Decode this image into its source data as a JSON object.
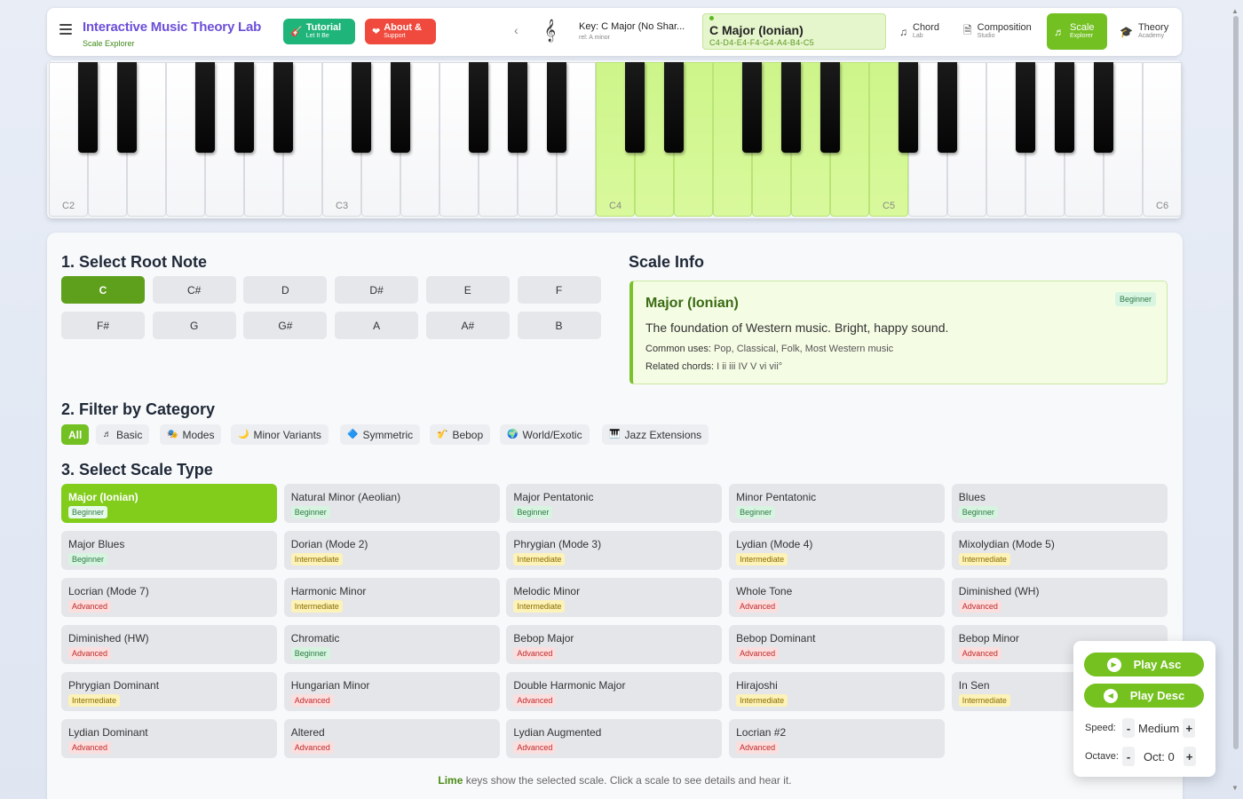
{
  "header": {
    "title": "Interactive Music Theory Lab",
    "subtitle": "Scale Explorer",
    "tutorial": {
      "t1": "Tutorial",
      "t2": "Let It Be"
    },
    "about": {
      "t1": "About &",
      "t2": "Support"
    },
    "key_line1": "Key: C Major (No Shar...",
    "key_line2": "rel: A minor",
    "scale_title": "C Major (Ionian)",
    "scale_notes": "C4-D4-E4-F4-G4-A4-B4-C5",
    "nav": [
      {
        "t1": "Chord",
        "t2": "Lab"
      },
      {
        "t1": "Composition",
        "t2": "Studio"
      },
      {
        "t1": "Scale",
        "t2": "Explorer"
      },
      {
        "t1": "Theory",
        "t2": "Academy"
      }
    ],
    "accent": "#72c022"
  },
  "piano": {
    "white_count": 29,
    "lit_from": 14,
    "lit_to": 21,
    "labels": [
      {
        "index": 0,
        "text": "C2"
      },
      {
        "index": 7,
        "text": "C3"
      },
      {
        "index": 14,
        "text": "C4"
      },
      {
        "index": 21,
        "text": "C5"
      },
      {
        "index": 28,
        "text": "C6"
      }
    ]
  },
  "root": {
    "heading": "1. Select Root Note",
    "notes": [
      "C",
      "C#",
      "D",
      "D#",
      "E",
      "F",
      "F#",
      "G",
      "G#",
      "A",
      "A#",
      "B"
    ],
    "selected": "C"
  },
  "info": {
    "heading": "Scale Info",
    "title": "Major (Ionian)",
    "level": "Beginner",
    "description": "The foundation of Western music. Bright, happy sound.",
    "uses_label": "Common uses:",
    "uses": "Pop, Classical, Folk, Most Western music",
    "chords_label": "Related chords:",
    "chords": "I ii iii IV V vi vii°"
  },
  "filter": {
    "heading": "2. Filter by Category",
    "items": [
      {
        "icon": "",
        "label": "All"
      },
      {
        "icon": "♬",
        "label": "Basic"
      },
      {
        "icon": "🎭",
        "label": "Modes"
      },
      {
        "icon": "🌙",
        "label": "Minor Variants"
      },
      {
        "icon": "🔷",
        "label": "Symmetric"
      },
      {
        "icon": "🎷",
        "label": "Bebop"
      },
      {
        "icon": "🌍",
        "label": "World/Exotic"
      },
      {
        "icon": "🎹",
        "label": "Jazz Extensions"
      }
    ]
  },
  "scales": {
    "heading": "3. Select Scale Type",
    "items": [
      {
        "name": "Major (Ionian)",
        "level": "Beginner"
      },
      {
        "name": "Natural Minor (Aeolian)",
        "level": "Beginner"
      },
      {
        "name": "Major Pentatonic",
        "level": "Beginner"
      },
      {
        "name": "Minor Pentatonic",
        "level": "Beginner"
      },
      {
        "name": "Blues",
        "level": "Beginner"
      },
      {
        "name": "Major Blues",
        "level": "Beginner"
      },
      {
        "name": "Dorian (Mode 2)",
        "level": "Intermediate"
      },
      {
        "name": "Phrygian (Mode 3)",
        "level": "Intermediate"
      },
      {
        "name": "Lydian (Mode 4)",
        "level": "Intermediate"
      },
      {
        "name": "Mixolydian (Mode 5)",
        "level": "Intermediate"
      },
      {
        "name": "Locrian (Mode 7)",
        "level": "Advanced"
      },
      {
        "name": "Harmonic Minor",
        "level": "Intermediate"
      },
      {
        "name": "Melodic Minor",
        "level": "Intermediate"
      },
      {
        "name": "Whole Tone",
        "level": "Advanced"
      },
      {
        "name": "Diminished (WH)",
        "level": "Advanced"
      },
      {
        "name": "Diminished (HW)",
        "level": "Advanced"
      },
      {
        "name": "Chromatic",
        "level": "Beginner"
      },
      {
        "name": "Bebop Major",
        "level": "Advanced"
      },
      {
        "name": "Bebop Dominant",
        "level": "Advanced"
      },
      {
        "name": "Bebop Minor",
        "level": "Advanced"
      },
      {
        "name": "Phrygian Dominant",
        "level": "Intermediate"
      },
      {
        "name": "Hungarian Minor",
        "level": "Advanced"
      },
      {
        "name": "Double Harmonic Major",
        "level": "Advanced"
      },
      {
        "name": "Hirajoshi",
        "level": "Intermediate"
      },
      {
        "name": "In Sen",
        "level": "Intermediate"
      },
      {
        "name": "Lydian Dominant",
        "level": "Advanced"
      },
      {
        "name": "Altered",
        "level": "Advanced"
      },
      {
        "name": "Lydian Augmented",
        "level": "Advanced"
      },
      {
        "name": "Locrian #2",
        "level": "Advanced"
      }
    ]
  },
  "footnote": {
    "lime": "Lime",
    "rest": " keys show the selected scale. Click a scale to see details and hear it."
  },
  "player": {
    "asc": "Play Asc",
    "desc": "Play Desc",
    "speed_label": "Speed:",
    "speed_value": "Medium",
    "octave_label": "Octave:",
    "octave_value": "Oct: 0",
    "minus": "-",
    "plus": "+"
  }
}
